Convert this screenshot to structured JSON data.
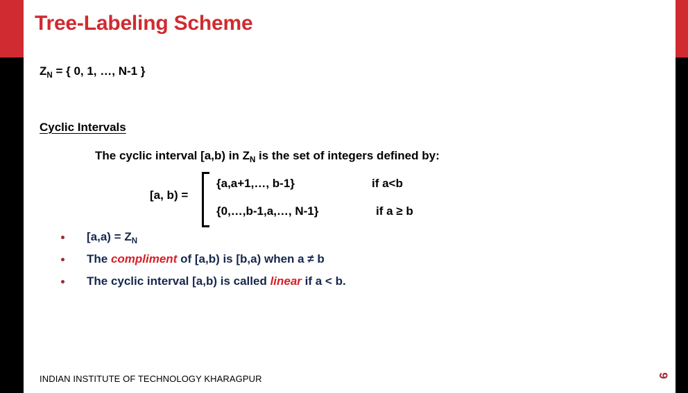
{
  "slide": {
    "title": "Tree-Labeling Scheme",
    "page_number": "9",
    "footer": "INDIAN INSTITUTE OF TECHNOLOGY KHARAGPUR",
    "colors": {
      "title_red": "#cf2b30",
      "accent_bar_red": "#cf2b30",
      "accent_bar_black": "#000000",
      "body_text": "#000000",
      "bullet_text_navy": "#16274d",
      "emphasis_red": "#d81f26",
      "bullet_marker_red": "#9e2a33",
      "page_number_red": "#9e2a33",
      "background": "#ffffff"
    }
  },
  "content": {
    "set_definition": {
      "symbol": "Z",
      "subscript": "N",
      "equals_body": " = { 0, 1, …, N-1 }"
    },
    "section_heading": "Cyclic Intervals",
    "definition_line": {
      "part1": "The cyclic interval [a,b) in Z",
      "subscript": "N",
      "part2": " is the set of integers defined by:"
    },
    "cases": {
      "lhs": "[a, b) =",
      "rows": [
        {
          "expression": "{a,a+1,…, b-1}",
          "condition": "if a<b"
        },
        {
          "expression": "{0,…,b-1,a,…, N-1}",
          "condition": "if a ≥ b"
        }
      ]
    },
    "bullets": [
      {
        "segments": [
          {
            "text": "[a,a) = Z",
            "style": "plain"
          },
          {
            "text": "N",
            "style": "sub"
          }
        ]
      },
      {
        "segments": [
          {
            "text": "The ",
            "style": "plain"
          },
          {
            "text": "compliment",
            "style": "em-red"
          },
          {
            "text": " of [a,b) is [b,a) when a ≠ b",
            "style": "plain"
          }
        ]
      },
      {
        "segments": [
          {
            "text": "The cyclic interval [a,b) is called ",
            "style": "plain"
          },
          {
            "text": "linear",
            "style": "em-red"
          },
          {
            "text": " if a < b.",
            "style": "plain"
          }
        ]
      }
    ]
  }
}
